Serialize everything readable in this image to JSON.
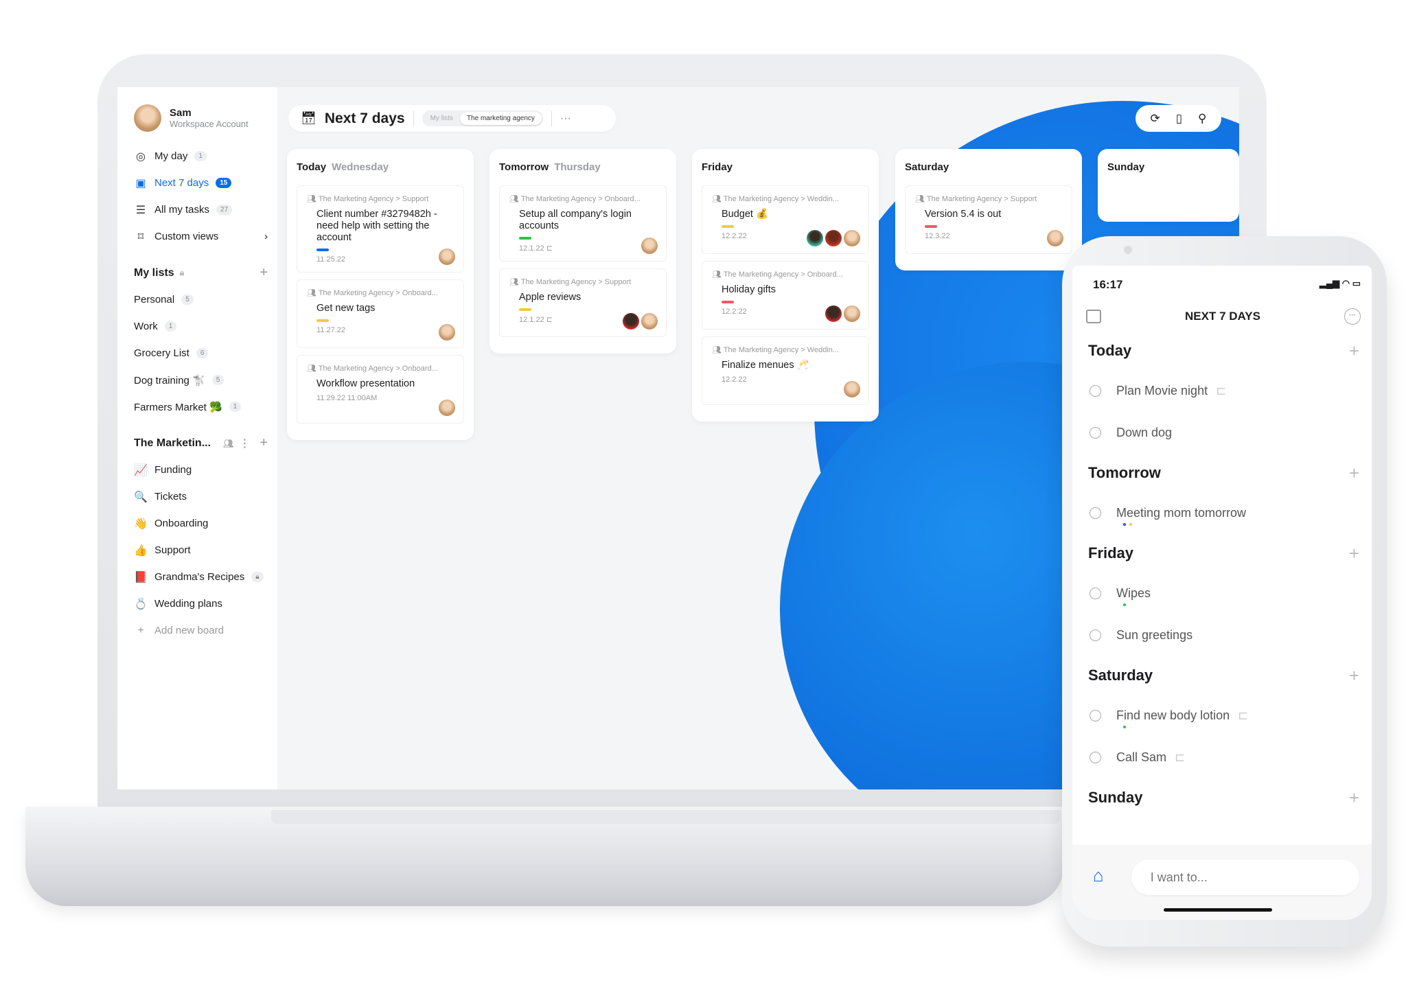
{
  "colors": {
    "accent": "#0a6cf0",
    "blob": "#0b74e6"
  },
  "sidebar": {
    "user": {
      "name": "Sam",
      "subtitle": "Workspace Account"
    },
    "nav": [
      {
        "icon": "target-icon",
        "glyph": "◎",
        "label": "My day",
        "count": "1"
      },
      {
        "icon": "calendar-icon",
        "glyph": "▣",
        "label": "Next 7 days",
        "count": "15",
        "active": true
      },
      {
        "icon": "list-icon",
        "glyph": "☰",
        "label": "All my tasks",
        "count": "27"
      },
      {
        "icon": "bookmark-icon",
        "glyph": "⌑",
        "label": "Custom views",
        "chevron": "›"
      }
    ],
    "my_lists": {
      "title": "My lists",
      "items": [
        {
          "label": "Personal",
          "count": "5"
        },
        {
          "label": "Work",
          "count": "1"
        },
        {
          "label": "Grocery List",
          "count": "6"
        },
        {
          "label": "Dog training 🐩",
          "count": "5"
        },
        {
          "label": "Farmers Market 🥦",
          "count": "1"
        }
      ]
    },
    "workspace": {
      "title": "The Marketin...",
      "items": [
        {
          "emoji": "📈",
          "label": "Funding"
        },
        {
          "emoji": "🔍",
          "label": "Tickets"
        },
        {
          "emoji": "👋",
          "label": "Onboarding"
        },
        {
          "emoji": "👍",
          "label": "Support"
        },
        {
          "emoji": "📕",
          "label": "Grandma's Recipes",
          "locked": true
        },
        {
          "emoji": "💍",
          "label": "Wedding plans"
        }
      ],
      "add_label": "Add new board"
    }
  },
  "header": {
    "title": "Next 7 days",
    "tabs": [
      {
        "label": "My lists"
      },
      {
        "label": "The marketing agency",
        "active": true
      }
    ],
    "more": "···"
  },
  "columns": [
    {
      "day": "Today",
      "sub": "Wednesday",
      "cards": [
        {
          "crumb": "The Marketing Agency > Support",
          "title": "Client number #3279482h - need help with setting the account",
          "priority": "#0a6cf0",
          "date": "11.25.22",
          "avatars": [
            "sam"
          ]
        },
        {
          "crumb": "The Marketing Agency > Onboard...",
          "title": "Get new tags",
          "priority": "#f5c842",
          "date": "11.27.22",
          "avatars": [
            "sam"
          ]
        },
        {
          "crumb": "The Marketing Agency > Onboard...",
          "title": "Workflow presentation",
          "date": "11.29.22 11:00AM",
          "avatars": [
            "sam"
          ]
        }
      ]
    },
    {
      "day": "Tomorrow",
      "sub": "Thursday",
      "cards": [
        {
          "crumb": "The Marketing Agency > Onboard...",
          "title": "Setup all company's login accounts",
          "priority": "#2ec24a",
          "date": "12.1.22",
          "subtask": true,
          "avatars": [
            "sam"
          ]
        },
        {
          "crumb": "The Marketing Agency > Support",
          "title": "Apple reviews",
          "priority": "#f5c842",
          "date": "12.1.22",
          "subtask": true,
          "avatars": [
            "dark",
            "sam"
          ]
        }
      ]
    },
    {
      "day": "Friday",
      "sub": "",
      "cards": [
        {
          "crumb": "The Marketing Agency > Weddin...",
          "title": "Budget 💰",
          "priority": "#f5c842",
          "date": "12.2.22",
          "avatars": [
            "teal",
            "red",
            "sam"
          ]
        },
        {
          "crumb": "The Marketing Agency > Onboard...",
          "title": "Holiday gifts",
          "priority": "#f25767",
          "date": "12.2.22",
          "avatars": [
            "dark",
            "sam"
          ]
        },
        {
          "crumb": "The Marketing Agency > Weddin...",
          "title": "Finalize menues 🥂",
          "date": "12.2.22",
          "avatars": [
            "sam"
          ]
        }
      ]
    },
    {
      "day": "Saturday",
      "sub": "",
      "cards": [
        {
          "crumb": "The Marketing Agency > Support",
          "title": "Version 5.4 is out",
          "priority": "#f25767",
          "date": "12.3.22",
          "avatars": [
            "sam"
          ]
        }
      ]
    },
    {
      "day": "Sunday",
      "sub": "",
      "cards": []
    }
  ],
  "phone": {
    "time": "16:17",
    "title": "NEXT 7 DAYS",
    "input_placeholder": "I want to...",
    "sections": [
      {
        "day": "Today",
        "items": [
          {
            "label": "Plan Movie night",
            "subtask": true
          },
          {
            "label": "Down dog"
          }
        ]
      },
      {
        "day": "Tomorrow",
        "items": [
          {
            "label": "Meeting mom tomorrow",
            "dots": [
              "#2d4fe0",
              "#f5c842"
            ]
          }
        ]
      },
      {
        "day": "Friday",
        "items": [
          {
            "label": "Wipes",
            "dots": [
              "#2ec24a"
            ]
          },
          {
            "label": "Sun greetings"
          }
        ]
      },
      {
        "day": "Saturday",
        "items": [
          {
            "label": "Find new body lotion",
            "subtask": true,
            "dots": [
              "#2ec24a"
            ]
          },
          {
            "label": "Call Sam",
            "subtask": true
          }
        ]
      },
      {
        "day": "Sunday",
        "items": []
      }
    ]
  }
}
